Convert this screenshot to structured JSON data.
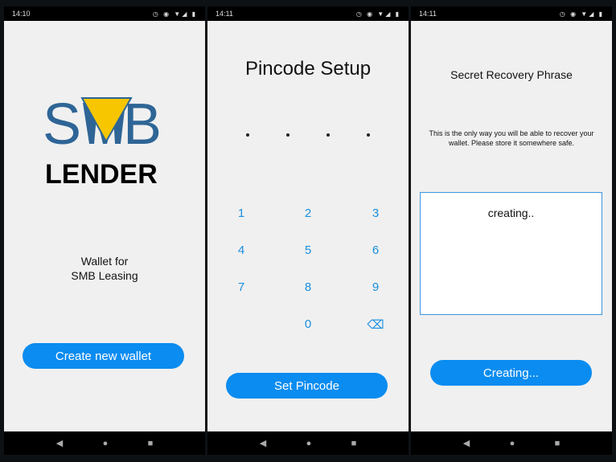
{
  "status_bars": [
    {
      "time": "14:10"
    },
    {
      "time": "14:11"
    },
    {
      "time": "14:11"
    }
  ],
  "status_icons": "◷ ◉ ▼◢ ▮",
  "screen1": {
    "logo_text": "SMB LENDER",
    "tagline_line1": "Wallet for",
    "tagline_line2": "SMB Leasing",
    "create_button": "Create new wallet",
    "colors": {
      "logo_blue": "#2e6596",
      "logo_yellow": "#f7c600"
    }
  },
  "screen2": {
    "title": "Pincode Setup",
    "pin_dots": 4,
    "keys": [
      "1",
      "2",
      "3",
      "4",
      "5",
      "6",
      "7",
      "8",
      "9",
      "0"
    ],
    "backspace_icon": "⌫",
    "set_button": "Set Pincode"
  },
  "screen3": {
    "title": "Secret Recovery Phrase",
    "description": "This is the only way you will be able to recover your wallet. Please store it somewhere safe.",
    "phrase_box": "creating..",
    "creating_button": "Creating..."
  },
  "nav": {
    "back": "◀",
    "home": "●",
    "recents": "■"
  },
  "accent": "#0a8cf0"
}
